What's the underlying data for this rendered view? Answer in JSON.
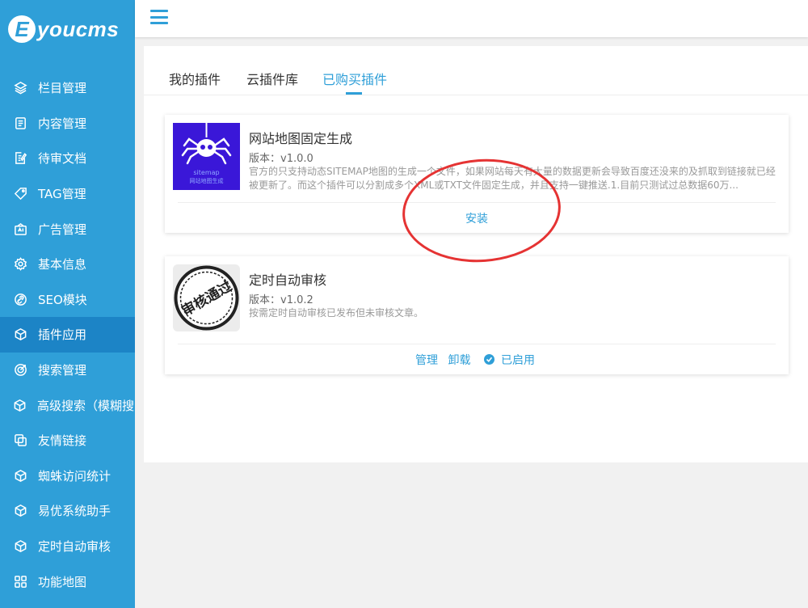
{
  "app": {
    "logo_letter": "E",
    "logo_text": "youcms"
  },
  "sidebar": {
    "items": [
      {
        "label": "栏目管理",
        "icon": "layers-icon"
      },
      {
        "label": "内容管理",
        "icon": "document-icon"
      },
      {
        "label": "待审文档",
        "icon": "edit-document-icon"
      },
      {
        "label": "TAG管理",
        "icon": "tag-icon"
      },
      {
        "label": "广告管理",
        "icon": "ad-icon"
      },
      {
        "label": "基本信息",
        "icon": "gear-icon"
      },
      {
        "label": "SEO模块",
        "icon": "link-icon"
      },
      {
        "label": "插件应用",
        "icon": "cube-icon",
        "active": true
      },
      {
        "label": "搜索管理",
        "icon": "target-icon"
      },
      {
        "label": "高级搜索（模糊搜索）",
        "icon": "cube-icon"
      },
      {
        "label": "友情链接",
        "icon": "copy-icon"
      },
      {
        "label": "蜘蛛访问统计",
        "icon": "cube-icon"
      },
      {
        "label": "易优系统助手",
        "icon": "cube-icon"
      },
      {
        "label": "定时自动审核",
        "icon": "cube-icon"
      },
      {
        "label": "功能地图",
        "icon": "grid-icon"
      }
    ]
  },
  "tabs": [
    {
      "label": "我的插件"
    },
    {
      "label": "云插件库"
    },
    {
      "label": "已购买插件",
      "active": true
    }
  ],
  "plugins": [
    {
      "title": "网站地图固定生成",
      "version": "版本：v1.0.0",
      "description": "官方的只支持动态SITEMAP地图的生成一个文件，如果网站每天有大量的数据更新会导致百度还没来的及抓取到链接就已经被更新了。而这个插件可以分割成多个XML或TXT文件固定生成，并且支持一键推送.1.目前只测试过总数据60万...",
      "image_label_1": "sitemap",
      "image_label_2": "网站地图生成",
      "action_install": "安装"
    },
    {
      "title": "定时自动审核",
      "version": "版本：v1.0.2",
      "description": "按需定时自动审核已发布但未审核文章。",
      "stamp_text": "审核通过",
      "action_manage": "管理",
      "action_uninstall": "卸载",
      "status_enabled": "已启用"
    }
  ],
  "colors": {
    "accent": "#2f9fd8",
    "sidebar_active": "#1c84c6",
    "annotation": "#e53333",
    "plugin1_bg": "#3a17d8"
  }
}
